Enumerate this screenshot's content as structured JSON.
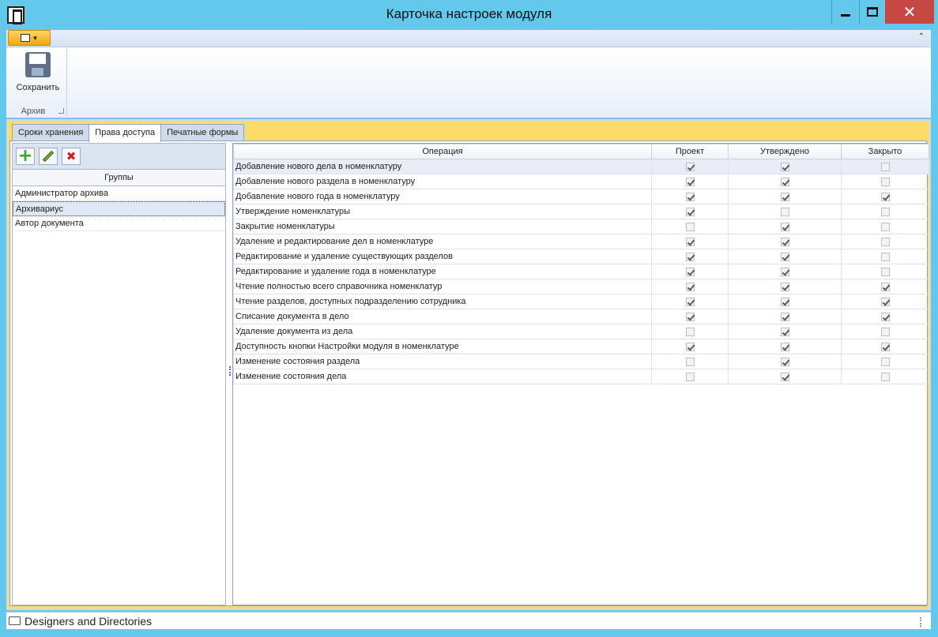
{
  "window": {
    "title": "Карточка настроек модуля"
  },
  "ribbon": {
    "save_label": "Сохранить",
    "group_label": "Архив"
  },
  "tabs": [
    {
      "label": "Сроки хранения"
    },
    {
      "label": "Права доступа"
    },
    {
      "label": "Печатные формы"
    }
  ],
  "groups": {
    "header": "Группы",
    "items": [
      "Администратор архива",
      "Архивариус",
      "Автор документа"
    ],
    "selected": "Архивариус"
  },
  "grid": {
    "columns": [
      "Операция",
      "Проект",
      "Утверждено",
      "Закрыто"
    ],
    "rows": [
      {
        "op": "Добавление нового дела в номенклатуру",
        "project": true,
        "approved": true,
        "closed": false
      },
      {
        "op": "Добавление нового раздела в номенклатуру",
        "project": true,
        "approved": true,
        "closed": false
      },
      {
        "op": "Добавление нового года в номенклатуру",
        "project": true,
        "approved": true,
        "closed": true
      },
      {
        "op": "Утверждение номенклатуры",
        "project": true,
        "approved": false,
        "closed": false
      },
      {
        "op": "Закрытие номенклатуры",
        "project": false,
        "approved": true,
        "closed": false
      },
      {
        "op": "Удаление и редактирование дел в номенклатуре",
        "project": true,
        "approved": true,
        "closed": false
      },
      {
        "op": "Редактирование и удаление существующих разделов",
        "project": true,
        "approved": true,
        "closed": false
      },
      {
        "op": "Редактирование и удаление года в номенклатуре",
        "project": true,
        "approved": true,
        "closed": false
      },
      {
        "op": "Чтение полностью всего справочника номенклатур",
        "project": true,
        "approved": true,
        "closed": true
      },
      {
        "op": "Чтение разделов, доступных подразделению сотрудника",
        "project": true,
        "approved": true,
        "closed": true
      },
      {
        "op": "Списание документа в дело",
        "project": true,
        "approved": true,
        "closed": true
      },
      {
        "op": "Удаление документа из дела",
        "project": false,
        "approved": true,
        "closed": false
      },
      {
        "op": "Доступность кнопки Настройки модуля в номенклатуре",
        "project": true,
        "approved": true,
        "closed": true
      },
      {
        "op": "Изменение состояния раздела",
        "project": false,
        "approved": true,
        "closed": false
      },
      {
        "op": "Изменение состояния дела",
        "project": false,
        "approved": true,
        "closed": false
      }
    ]
  },
  "statusbar": {
    "text": "Designers and Directories"
  }
}
